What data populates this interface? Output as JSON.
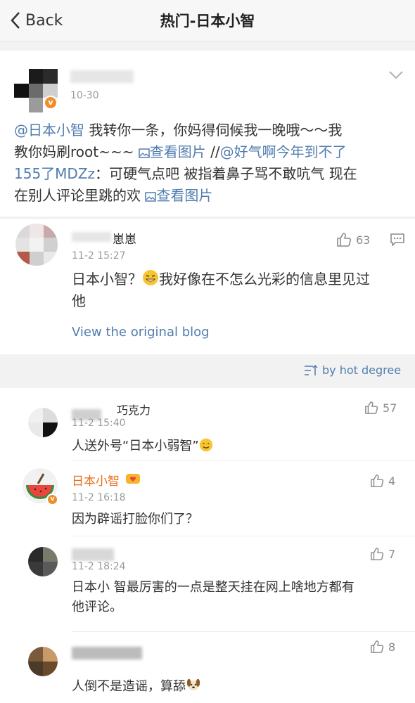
{
  "nav": {
    "back_label": "Back",
    "title": "热门-日本小智"
  },
  "post": {
    "time": "10-30",
    "line1_mention": "@日本小智",
    "line1_text": " 我转你一条，你妈得伺候我一晚哦～～我",
    "line2_text": "教你妈刷root~~~ ",
    "line2_pic": "查看图片",
    "line2_sep": " //",
    "line2_mention": "@好气啊今年到不了",
    "line3_mention": "155了MDZz",
    "line3_text": "：可硬气点吧 被指着鼻子骂不敢吭气 现在",
    "line4_text": "在别人评论里跳的欢 ",
    "line4_pic": "查看图片"
  },
  "hot_comment": {
    "name_suffix": "崽崽",
    "time": "11-2 15:27",
    "likes": "63",
    "line1": "日本小智？",
    "line1b": "我好像在不怎么光彩的信息里见过",
    "line2": "他",
    "view_original": "View the original blog"
  },
  "sort": {
    "label": "by hot degree"
  },
  "comments": [
    {
      "name": "巧克力",
      "time": "11-2 15:40",
      "likes": "57",
      "text": "人送外号“日本小弱智”"
    },
    {
      "name": "日本小智",
      "time": "11-2 16:18",
      "likes": "4",
      "text": "因为辟谣打脸你们了？"
    },
    {
      "name": "",
      "time": "11-2 18:24",
      "likes": "7",
      "text1": "日本小  智最厉害的一点是整天挂在网上啥地方都有",
      "text2": "他评论。"
    },
    {
      "name": "",
      "time": "",
      "likes": "8",
      "text": "人倒不是造谣，算舔"
    }
  ],
  "icons": [
    "chevron-left-icon",
    "chevron-down-icon",
    "thumbs-up-icon",
    "comment-icon",
    "image-icon",
    "sort-icon",
    "verified-badge-icon"
  ],
  "colors": {
    "link": "#507daf",
    "vip_name": "#e86f1e",
    "badge": "#f08d2b"
  }
}
